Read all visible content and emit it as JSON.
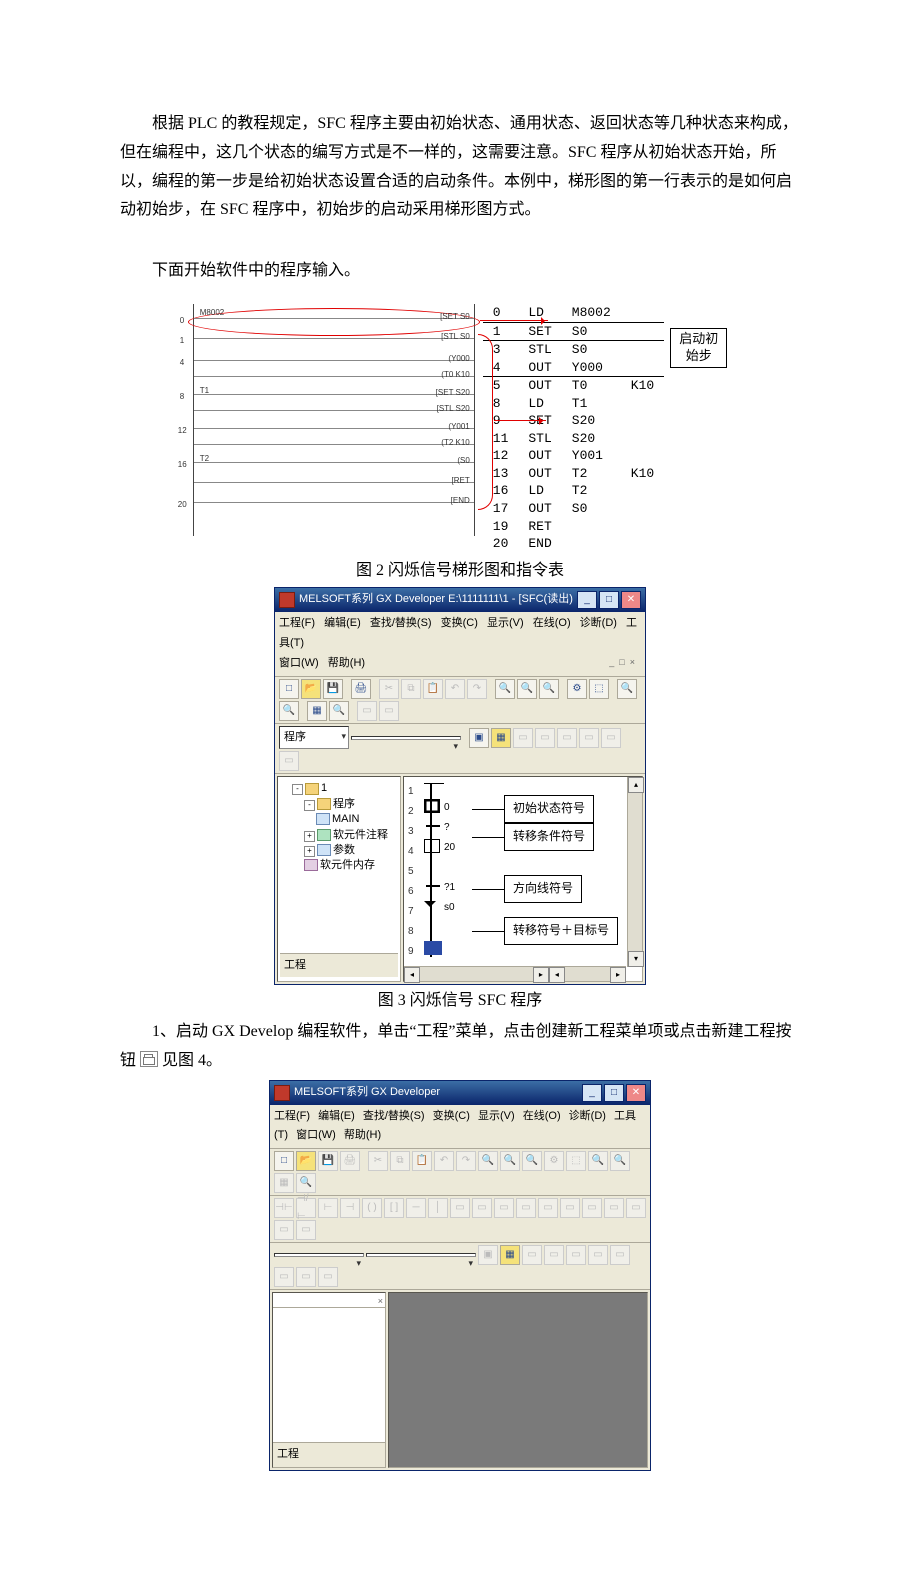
{
  "para1": "根据 PLC 的教程规定，SFC 程序主要由初始状态、通用状态、返回状态等几种状态来构成，但在编程中，这几个状态的编写方式是不一样的，这需要注意。SFC 程序从初始状态开始，所以，编程的第一步是给初始状态设置合适的启动条件。本例中，梯形图的第一行表示的是如何启动初始步，在 SFC 程序中，初始步的启动采用梯形图方式。",
  "para2": "下面开始软件中的程序输入。",
  "fig2": {
    "caption": "图 2 闪烁信号梯形图和指令表",
    "ladder_labels": {
      "m8002": "M8002",
      "set_s0": "[SET   S0",
      "stl_s0": "[STL   S0",
      "y000": "(Y000",
      "t0_k10": "(T0   K10",
      "t1": "T1",
      "set_s20": "[SET  S20",
      "stl_s20": "[STL  S20",
      "y001": "(Y001",
      "t2_k10": "(T2   K10",
      "t2": "T2",
      "s0": "(S0",
      "ret": "[RET",
      "end": "[END",
      "row_nums": [
        "0",
        "1",
        "3",
        "4",
        "5",
        "8",
        "9",
        "11",
        "12",
        "13",
        "16",
        "17",
        "19",
        "20"
      ]
    },
    "instructions": [
      {
        "step": "0",
        "op": "LD",
        "dev": "M8002",
        "ext": ""
      },
      {
        "step": "1",
        "op": "SET",
        "dev": "S0",
        "ext": ""
      },
      {
        "step": "3",
        "op": "STL",
        "dev": "S0",
        "ext": ""
      },
      {
        "step": "4",
        "op": "OUT",
        "dev": "Y000",
        "ext": ""
      },
      {
        "step": "5",
        "op": "OUT",
        "dev": "T0",
        "ext": "K10"
      },
      {
        "step": "8",
        "op": "LD",
        "dev": "T1",
        "ext": ""
      },
      {
        "step": "9",
        "op": "SET",
        "dev": "S20",
        "ext": ""
      },
      {
        "step": "11",
        "op": "STL",
        "dev": "S20",
        "ext": ""
      },
      {
        "step": "12",
        "op": "OUT",
        "dev": "Y001",
        "ext": ""
      },
      {
        "step": "13",
        "op": "OUT",
        "dev": "T2",
        "ext": "K10"
      },
      {
        "step": "16",
        "op": "LD",
        "dev": "T2",
        "ext": ""
      },
      {
        "step": "17",
        "op": "OUT",
        "dev": "S0",
        "ext": ""
      },
      {
        "step": "19",
        "op": "RET",
        "dev": "",
        "ext": ""
      },
      {
        "step": "20",
        "op": "END",
        "dev": "",
        "ext": ""
      }
    ],
    "callout": "启动初\n始步"
  },
  "fig3": {
    "caption": "图 3 闪烁信号 SFC 程序",
    "title": "MELSOFT系列 GX Developer E:\\1111111\\1 - [SFC(读出)",
    "menu": [
      "工程(F)",
      "编辑(E)",
      "查找/替换(S)",
      "变换(C)",
      "显示(V)",
      "在线(O)",
      "诊断(D)",
      "工具(T)",
      "窗口(W)",
      "帮助(H)"
    ],
    "dropdown1": "程序",
    "dropdown2": "",
    "tree_root": "1",
    "tree": {
      "program": "程序",
      "main": "MAIN",
      "comment": "软元件注释",
      "param": "参数",
      "mem": "软元件内存"
    },
    "tree_tab": "工程",
    "sfc": {
      "rows": [
        "1",
        "2",
        "3",
        "4",
        "5",
        "6",
        "7",
        "8",
        "9"
      ],
      "step0": "0",
      "tran0": "?",
      "step20": "20",
      "tran1": "?1",
      "jump": "s0"
    },
    "annotations": [
      "初始状态符号",
      "转移条件符号",
      "方向线符号",
      "转移符号＋目标号"
    ]
  },
  "para3_prefix": "1、启动 GX  Develop 编程软件，单击“工程”菜单，点击创建新工程菜单项或点击新建工程按钮",
  "para3_suffix": "见图 4。",
  "fig4": {
    "title": "MELSOFT系列 GX Developer",
    "menu": [
      "工程(F)",
      "编辑(E)",
      "查找/替换(S)",
      "变换(C)",
      "显示(V)",
      "在线(O)",
      "诊断(D)",
      "工具(T)",
      "窗口(W)",
      "帮助(H)"
    ],
    "tree_tab": "工程"
  }
}
